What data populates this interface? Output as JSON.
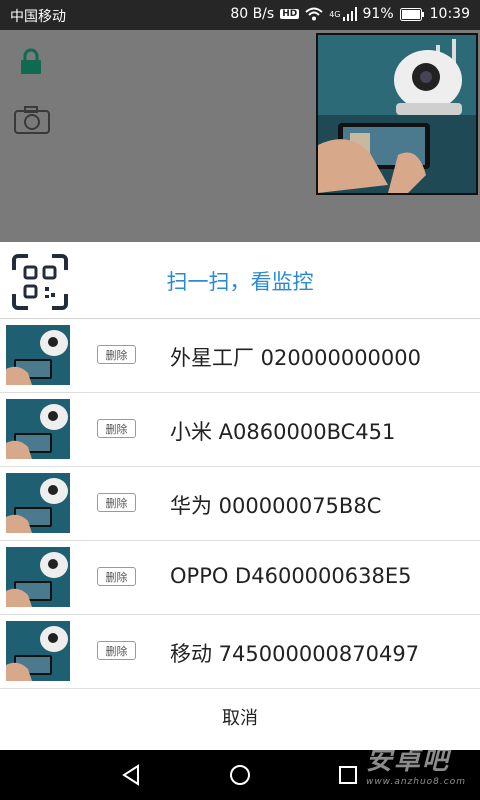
{
  "status_bar": {
    "carrier": "中国移动",
    "speed": "80 B/s",
    "hd_badge": "HD",
    "network": "4G",
    "battery": "91%",
    "time": "10:39"
  },
  "sheet": {
    "scan_label": "扫一扫，看监控",
    "devices": [
      {
        "delete_label": "删除",
        "name": "外星工厂  020000000000"
      },
      {
        "delete_label": "删除",
        "name": "小米  A0860000BC451"
      },
      {
        "delete_label": "删除",
        "name": "华为  000000075B8C"
      },
      {
        "delete_label": "删除",
        "name": "OPPO  D4600000638E5"
      },
      {
        "delete_label": "删除",
        "name": "移动  745000000870497"
      }
    ],
    "cancel_label": "取消"
  },
  "watermark": {
    "brand": "安卓吧",
    "url": "www.anzhuo8.com"
  },
  "colors": {
    "accent": "#2a8ad5",
    "lock": "#0f6b4f",
    "overlay": "#7a7a7a"
  }
}
